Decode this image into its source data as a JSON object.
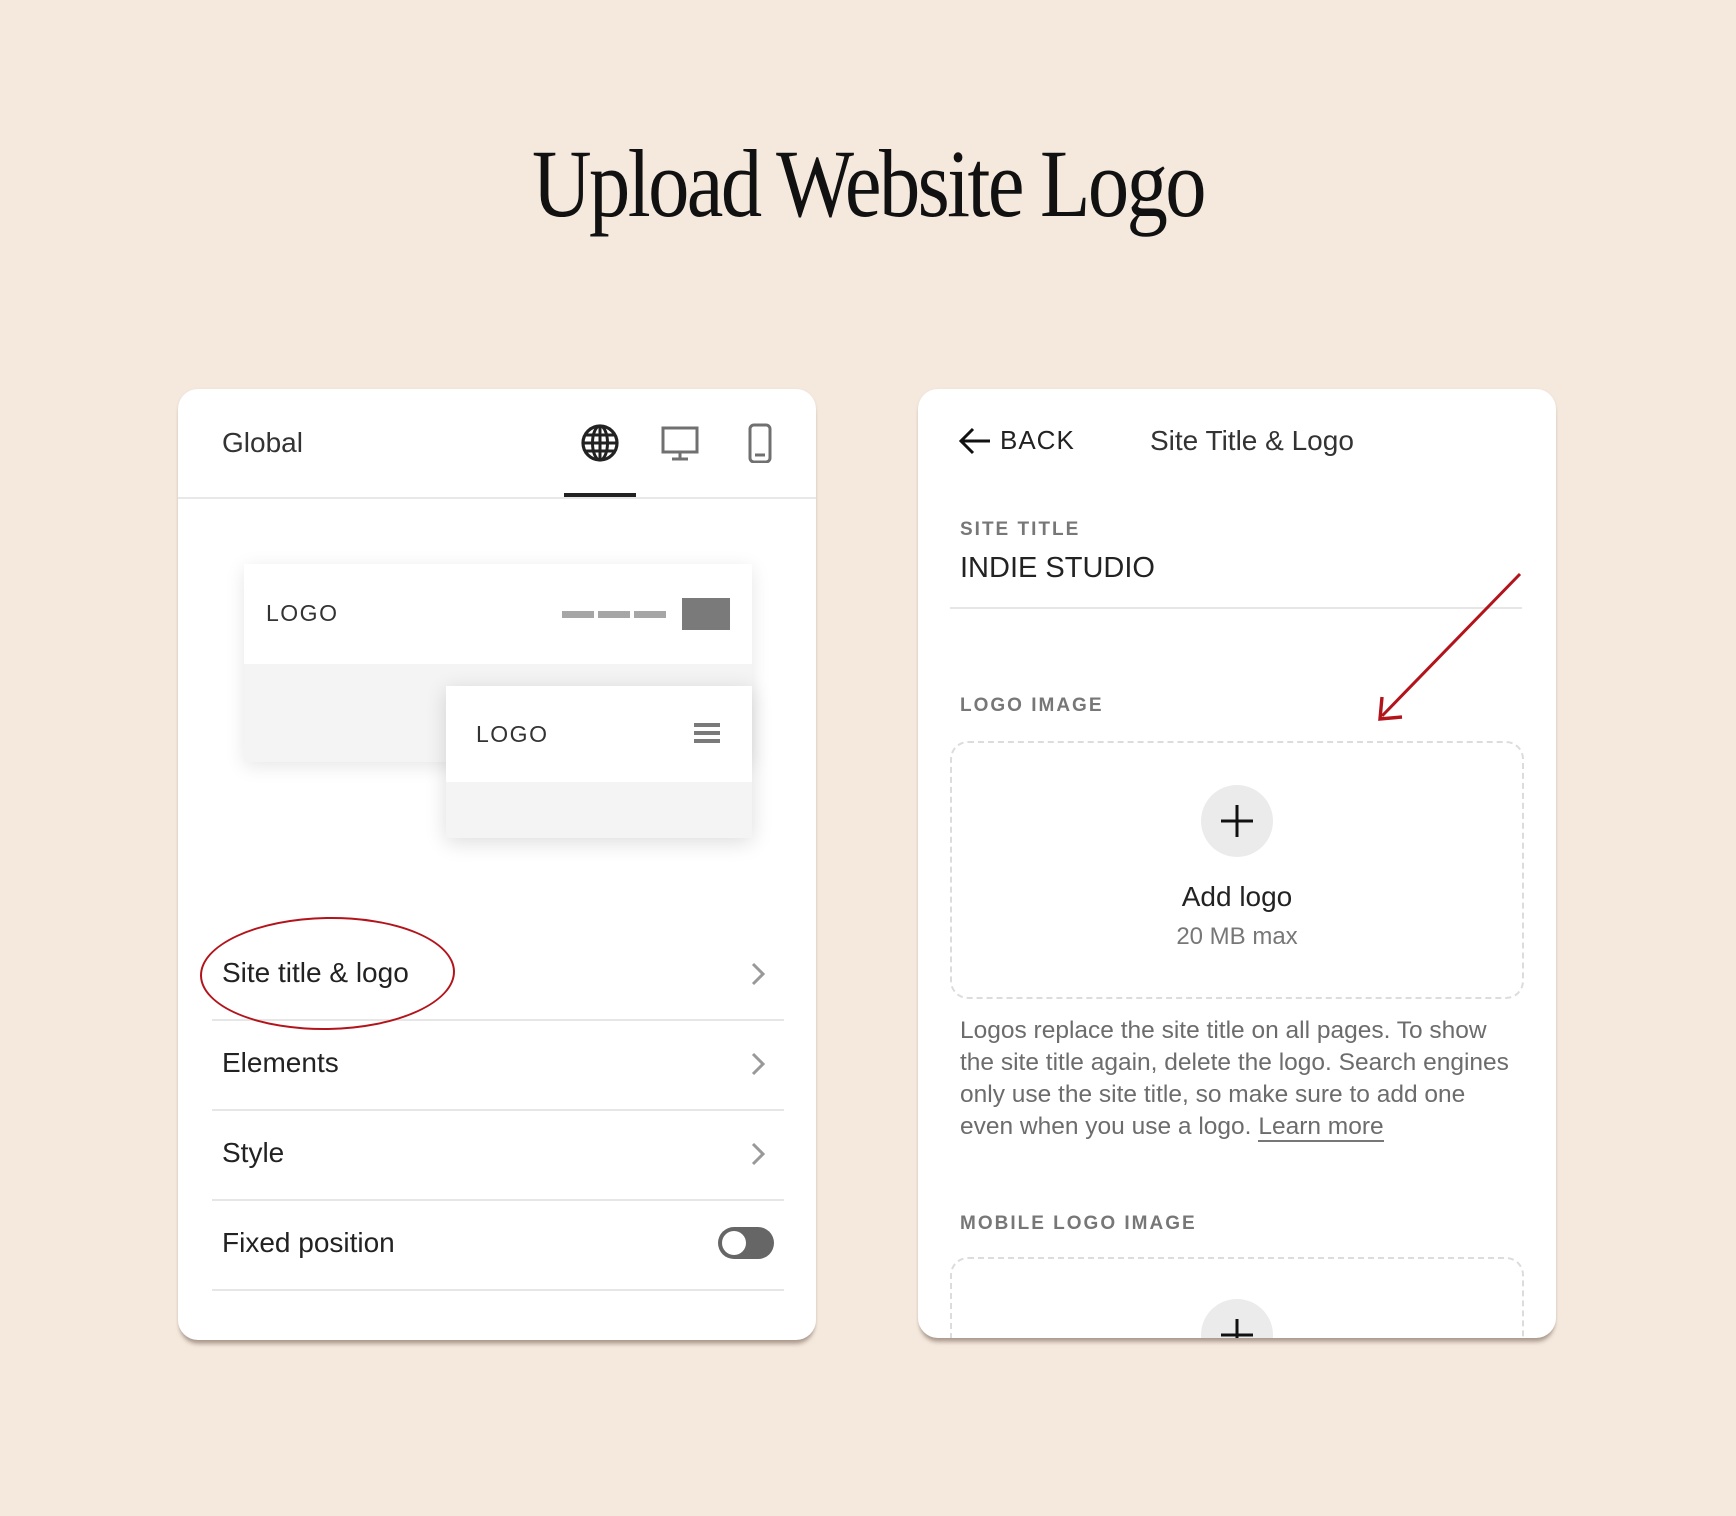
{
  "page": {
    "title": "Upload Website Logo"
  },
  "colors": {
    "background": "#f5e9de",
    "annotation_red": "#b3141b",
    "toggle_off": "#666666"
  },
  "left_panel": {
    "header": {
      "title": "Global",
      "tabs": [
        {
          "icon": "globe-icon",
          "label": "Global",
          "active": true
        },
        {
          "icon": "desktop-icon",
          "label": "Desktop",
          "active": false
        },
        {
          "icon": "mobile-icon",
          "label": "Mobile",
          "active": false
        }
      ]
    },
    "preview": {
      "desktop_logo": "LOGO",
      "mobile_logo": "LOGO"
    },
    "items": [
      {
        "label": "Site title & logo",
        "type": "link",
        "highlighted": true
      },
      {
        "label": "Elements",
        "type": "link"
      },
      {
        "label": "Style",
        "type": "link"
      },
      {
        "label": "Fixed position",
        "type": "toggle",
        "value": false
      }
    ]
  },
  "right_panel": {
    "back_label": "BACK",
    "title": "Site Title & Logo",
    "site_title": {
      "label": "SITE TITLE",
      "value": "INDIE STUDIO"
    },
    "logo_image": {
      "label": "LOGO IMAGE",
      "add_label": "Add logo",
      "max_size": "20 MB max"
    },
    "help_text": "Logos replace the site title on all pages. To show the site title again, delete the logo. Search engines only use the site title, so make sure to add one even when you use a logo.",
    "learn_more": "Learn more",
    "mobile_logo_image": {
      "label": "MOBILE LOGO IMAGE"
    }
  }
}
